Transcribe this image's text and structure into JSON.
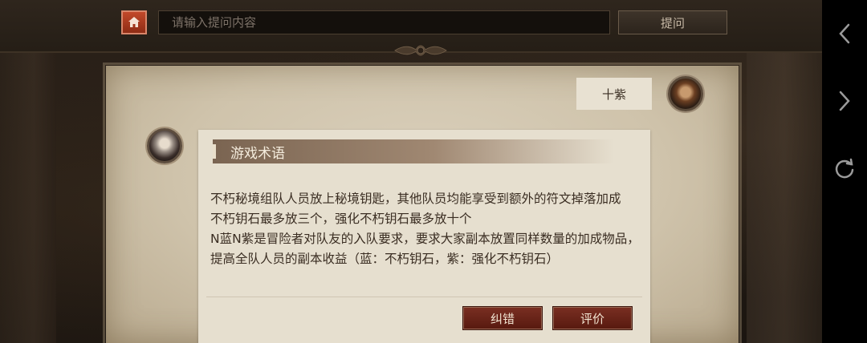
{
  "topbar": {
    "search_placeholder": "请输入提问内容",
    "ask_label": "提问"
  },
  "chat": {
    "user_message": "十紫",
    "answer": {
      "title": "游戏术语",
      "lines": [
        "不朽秘境组队人员放上秘境钥匙，其他队员均能享受到额外的符文掉落加成",
        "不朽钥石最多放三个，强化不朽钥石最多放十个",
        "N蓝N紫是冒险者对队友的入队要求，要求大家副本放置同样数量的加成物品，提高全队人员的副本收益（蓝：不朽钥石，紫：强化不朽钥石）"
      ],
      "correct_label": "纠错",
      "rate_label": "评价"
    }
  },
  "icons": {
    "home": "home-icon",
    "back": "chevron-left-icon",
    "forward": "chevron-right-icon",
    "refresh": "refresh-icon"
  },
  "colors": {
    "accent_red": "#8e2c15",
    "button_red": "#57190f",
    "parchment": "#d6cbb5"
  }
}
